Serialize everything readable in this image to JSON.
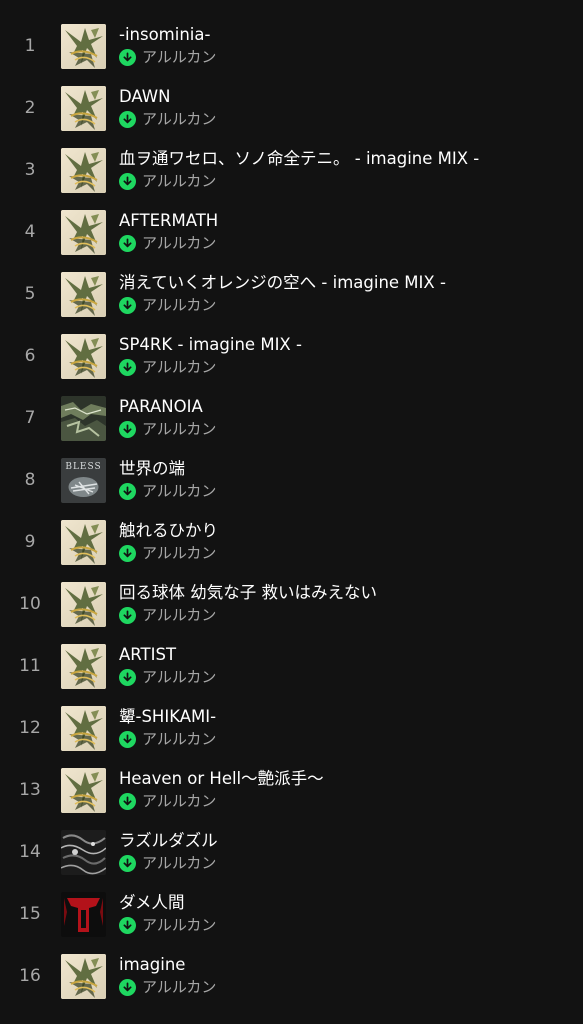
{
  "colors": {
    "background": "#121212",
    "primary_text": "#ffffff",
    "secondary_text": "#a7a7a7",
    "downloaded_accent": "#1ed760"
  },
  "tracks": [
    {
      "number": "1",
      "title": "-insominia-",
      "artist": "アルルカン",
      "art": "cover-a",
      "downloaded": true
    },
    {
      "number": "2",
      "title": "DAWN",
      "artist": "アルルカン",
      "art": "cover-a",
      "downloaded": true
    },
    {
      "number": "3",
      "title": "血ヲ通ワセロ、ソノ命全テニ。 - imagine MIX -",
      "artist": "アルルカン",
      "art": "cover-a",
      "downloaded": true
    },
    {
      "number": "4",
      "title": "AFTERMATH",
      "artist": "アルルカン",
      "art": "cover-a",
      "downloaded": true
    },
    {
      "number": "5",
      "title": "消えていくオレンジの空へ - imagine MIX -",
      "artist": "アルルカン",
      "art": "cover-a",
      "downloaded": true
    },
    {
      "number": "6",
      "title": "SP4RK - imagine MIX -",
      "artist": "アルルカン",
      "art": "cover-a",
      "downloaded": true
    },
    {
      "number": "7",
      "title": "PARANOIA",
      "artist": "アルルカン",
      "art": "cover-paranoia",
      "downloaded": true
    },
    {
      "number": "8",
      "title": "世界の端",
      "artist": "アルルカン",
      "art": "cover-bless",
      "art_text": "BLESS",
      "downloaded": true
    },
    {
      "number": "9",
      "title": "触れるひかり",
      "artist": "アルルカン",
      "art": "cover-a",
      "downloaded": true
    },
    {
      "number": "10",
      "title": "回る球体 幼気な子 救いはみえない",
      "artist": "アルルカン",
      "art": "cover-a",
      "downloaded": true
    },
    {
      "number": "11",
      "title": "ARTIST",
      "artist": "アルルカン",
      "art": "cover-a",
      "downloaded": true
    },
    {
      "number": "12",
      "title": "顰-SHIKAMI-",
      "artist": "アルルカン",
      "art": "cover-a",
      "downloaded": true
    },
    {
      "number": "13",
      "title": "Heaven or Hell〜艶派手〜",
      "artist": "アルルカン",
      "art": "cover-a",
      "downloaded": true
    },
    {
      "number": "14",
      "title": "ラズルダズル",
      "artist": "アルルカン",
      "art": "cover-razzle",
      "downloaded": true
    },
    {
      "number": "15",
      "title": "ダメ人間",
      "artist": "アルルカン",
      "art": "cover-dame",
      "downloaded": true
    },
    {
      "number": "16",
      "title": "imagine",
      "artist": "アルルカン",
      "art": "cover-a",
      "downloaded": true
    }
  ]
}
